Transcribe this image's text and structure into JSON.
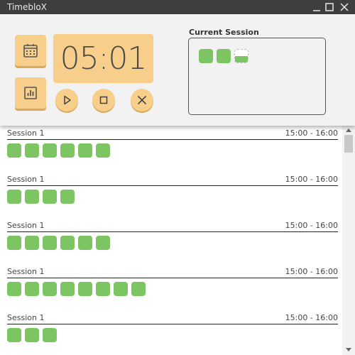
{
  "window": {
    "title": "TimebloX"
  },
  "icons": {
    "calendar": "calendar-icon",
    "stats": "bar-chart-icon",
    "play": "play-icon",
    "stop": "stop-icon",
    "cancel": "close-icon"
  },
  "timer": {
    "display": "05:01"
  },
  "current_session": {
    "label": "Current Session",
    "completed_blocks": 2,
    "partial_block_progress": 0.5
  },
  "sessions": [
    {
      "name": "Session 1",
      "time": "15:00 - 16:00",
      "blocks": 6
    },
    {
      "name": "Session 1",
      "time": "15:00 - 16:00",
      "blocks": 4
    },
    {
      "name": "Session 1",
      "time": "15:00 - 16:00",
      "blocks": 6
    },
    {
      "name": "Session 1",
      "time": "15:00 - 16:00",
      "blocks": 8
    },
    {
      "name": "Session 1",
      "time": "15:00 - 16:00",
      "blocks": 3
    }
  ],
  "colors": {
    "accent": "#f7cf8a",
    "block": "#7dc462",
    "titlebar": "#3e3e3e"
  }
}
